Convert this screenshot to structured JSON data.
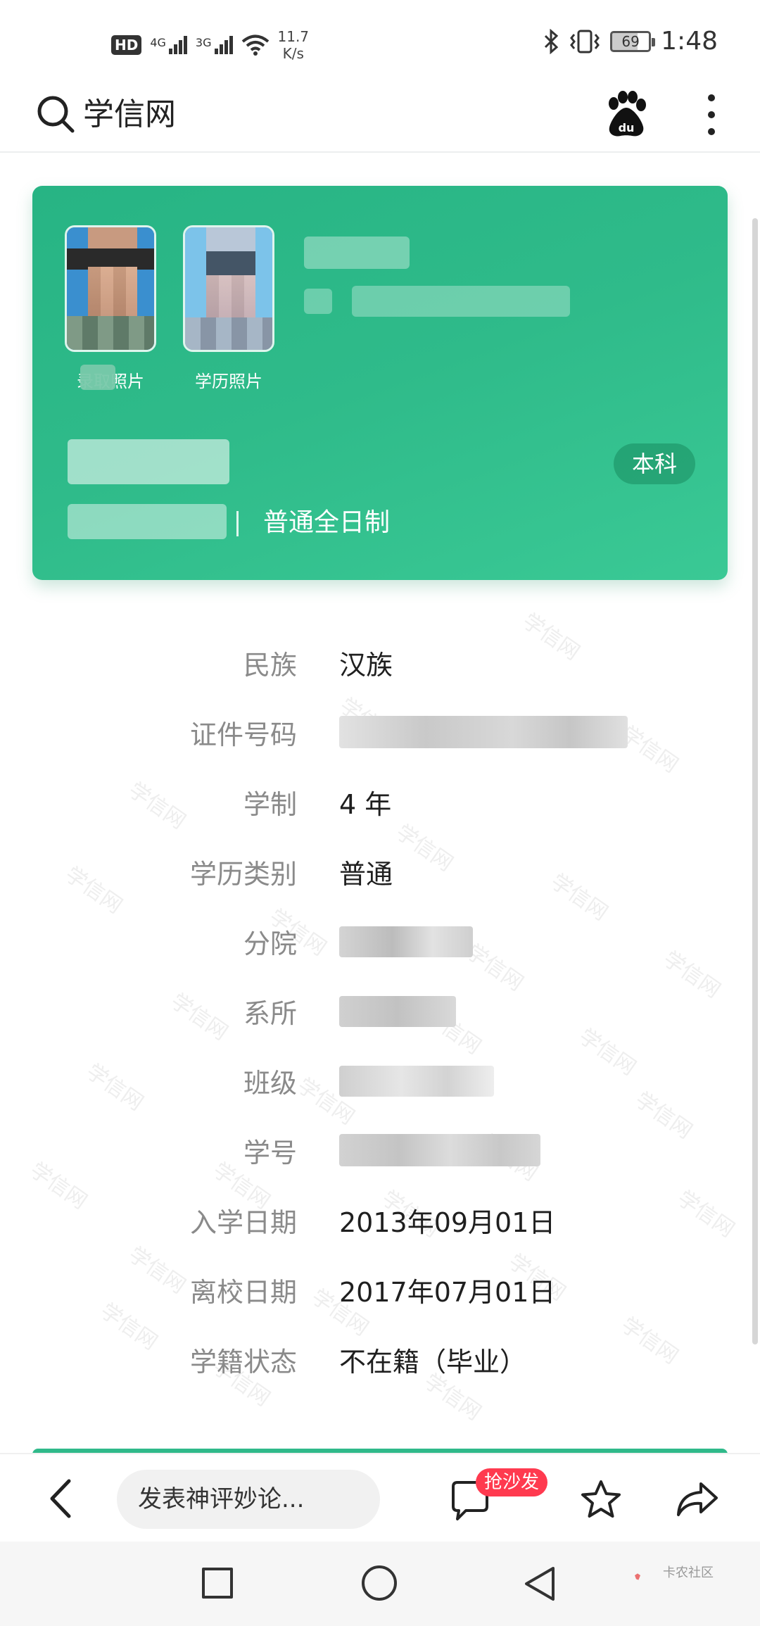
{
  "status_bar": {
    "hd": "HD",
    "net1": "4G",
    "net2": "3G",
    "speed_value": "11.7",
    "speed_unit": "K/s",
    "battery": "69",
    "time": "1:48"
  },
  "top_nav": {
    "title": "学信网"
  },
  "card": {
    "photo1_label": "录取照片",
    "photo2_label": "学历照片",
    "level": "本科",
    "study_form": "普通全日制",
    "accent_color": "#2eb98a"
  },
  "info": [
    {
      "label": "民族",
      "value": "汉族"
    },
    {
      "label": "证件号码",
      "value": ""
    },
    {
      "label": "学制",
      "value": "4 年"
    },
    {
      "label": "学历类别",
      "value": "普通"
    },
    {
      "label": "分院",
      "value": ""
    },
    {
      "label": "系所",
      "value": ""
    },
    {
      "label": "班级",
      "value": ""
    },
    {
      "label": "学号",
      "value": ""
    },
    {
      "label": "入学日期",
      "value": "2013年09月01日"
    },
    {
      "label": "离校日期",
      "value": "2017年07月01日"
    },
    {
      "label": "学籍状态",
      "value": "不在籍（毕业）"
    }
  ],
  "watermark_text": "学信网",
  "bottom_bar": {
    "comment_placeholder": "发表神评妙论...",
    "sofa_badge": "抢沙发",
    "badge_color": "#ff3a4f"
  },
  "footer_logo": "卡农社区",
  "icons": [
    "search-icon",
    "baidu-icon",
    "more-icon",
    "back-icon",
    "comment-icon",
    "star-icon",
    "share-icon",
    "recents-icon",
    "home-icon",
    "system-back-icon"
  ]
}
